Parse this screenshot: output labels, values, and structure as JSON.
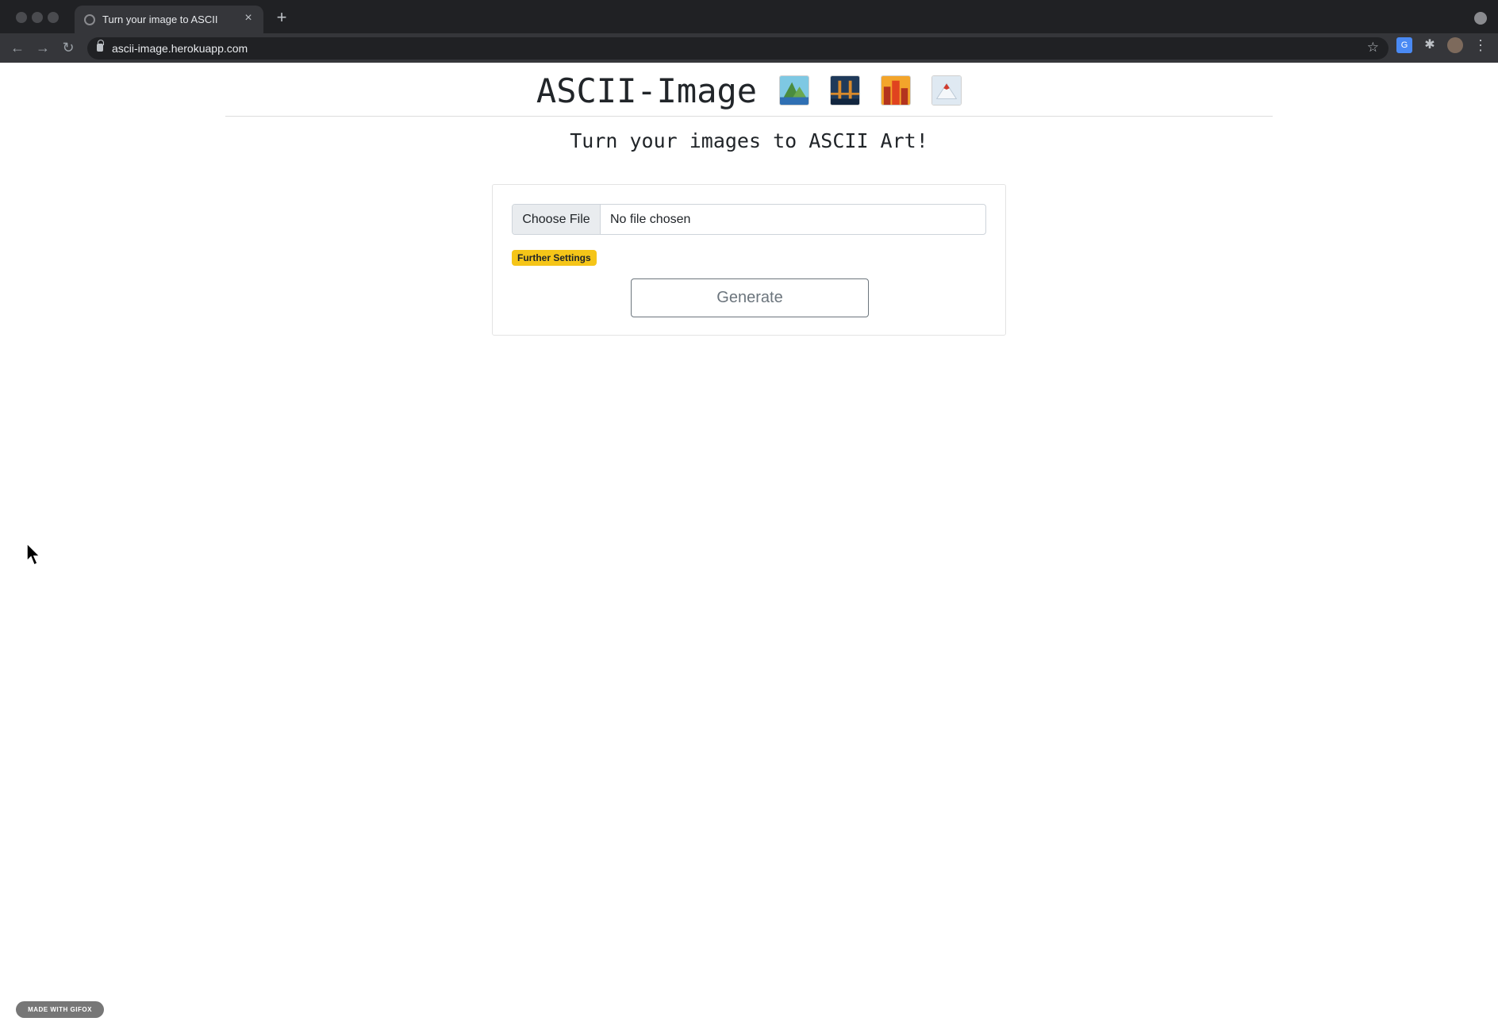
{
  "browser": {
    "tab_title": "Turn your image to ASCII",
    "tab_close": "×",
    "new_tab": "+",
    "url": "ascii-image.herokuapp.com",
    "back": "←",
    "forward": "→",
    "reload": "↻",
    "star": "☆",
    "translate_icon": "G",
    "extensions": "✱",
    "menu": "⋮"
  },
  "header": {
    "title": "ASCII-Image",
    "thumbnails": [
      {
        "name": "mountain-lake-thumbnail",
        "colors": [
          "#7ec8e3",
          "#4a8c3f",
          "#2f6fb3"
        ]
      },
      {
        "name": "bridge-night-thumbnail",
        "colors": [
          "#1f3a5a",
          "#d98a2b",
          "#12263f"
        ]
      },
      {
        "name": "city-sunset-thumbnail",
        "colors": [
          "#f3a52b",
          "#b3331e",
          "#e0431f"
        ]
      },
      {
        "name": "snowy-mountain-thumbnail",
        "colors": [
          "#dfe9f2",
          "#f4f7fa",
          "#d13b2d"
        ]
      }
    ]
  },
  "subtitle": "Turn your images to ASCII Art!",
  "form": {
    "file_button": "Choose File",
    "file_status": "No file chosen",
    "settings_badge": "Further Settings",
    "generate_button": "Generate"
  },
  "footer": {
    "watermark": "MADE WITH GIFOX"
  }
}
